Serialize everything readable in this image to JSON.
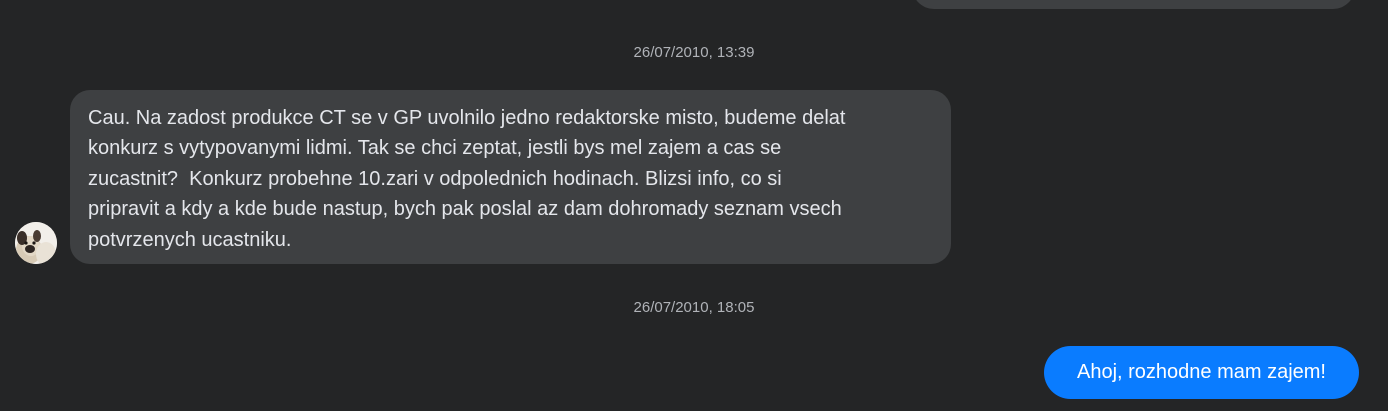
{
  "conversation": {
    "timestamp_1": "26/07/2010, 13:39",
    "timestamp_2": "26/07/2010, 18:05",
    "incoming_message": "Cau. Na zadost produkce CT se v GP uvolnilo jedno redaktorske misto, budeme delat\nkonkurz s vytypovanymi lidmi. Tak se chci zeptat, jestli bys mel zajem a cas se\nzucastnit?  Konkurz probehne 10.zari v odpolednich hodinach. Blizsi info, co si\npripravit a kdy a kde bude nastup, bych pak poslal az dam dohromady seznam vsech\npotvrzenych ucastniku.",
    "outgoing_message": "Ahoj, rozhodne mam zajem!",
    "avatar_icon": "pug-avatar-icon"
  },
  "colors": {
    "background": "#242526",
    "incoming_bubble": "#3e4042",
    "outgoing_bubble": "#0a7cff",
    "timestamp_text": "#b0b3b8",
    "message_text": "#e4e6eb"
  }
}
